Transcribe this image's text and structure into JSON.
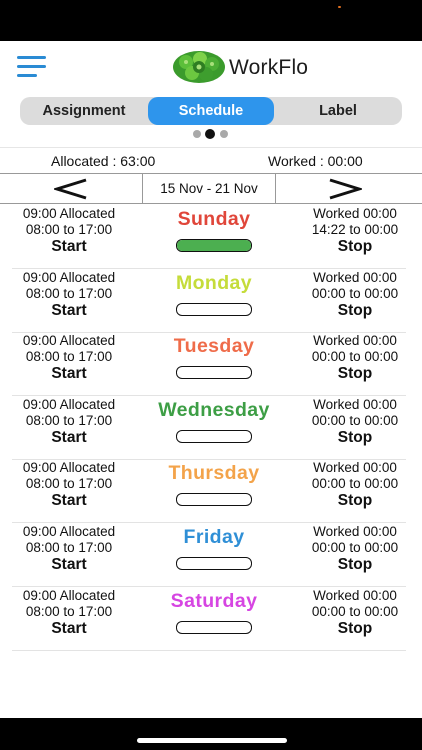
{
  "app": {
    "title": "WorkFlo"
  },
  "header": {
    "menu_icon": "hamburger-menu-icon",
    "logo_icon": "green-gear-logo"
  },
  "tabs": [
    {
      "label": "Assignment",
      "active": false
    },
    {
      "label": "Schedule",
      "active": true
    },
    {
      "label": "Label",
      "active": false
    }
  ],
  "pager": {
    "count": 3,
    "active_index": 1
  },
  "summary": {
    "allocated": "Allocated : 63:00",
    "worked": "Worked : 00:00"
  },
  "week": {
    "range": "15 Nov - 21 Nov",
    "prev_icon": "chevron-left-icon",
    "next_icon": "chevron-right-icon"
  },
  "colors": {
    "accent": "#2e95ec",
    "progress": "#4caf50"
  },
  "days": [
    {
      "name": "Sunday",
      "color": "#e0463a",
      "allocated": "09:00 Allocated",
      "range": "08:00 to 17:00",
      "start_label": "Start",
      "worked": "Worked 00:00",
      "worked_range": "14:22 to 00:00",
      "stop_label": "Stop",
      "progress": 1.0
    },
    {
      "name": "Monday",
      "color": "#c5dc3a",
      "allocated": "09:00 Allocated",
      "range": "08:00 to 17:00",
      "start_label": "Start",
      "worked": "Worked 00:00",
      "worked_range": "00:00 to 00:00",
      "stop_label": "Stop",
      "progress": 0
    },
    {
      "name": "Tuesday",
      "color": "#ef6c4a",
      "allocated": "09:00 Allocated",
      "range": "08:00 to 17:00",
      "start_label": "Start",
      "worked": "Worked 00:00",
      "worked_range": "00:00 to 00:00",
      "stop_label": "Stop",
      "progress": 0
    },
    {
      "name": "Wednesday",
      "color": "#3d9e45",
      "allocated": "09:00 Allocated",
      "range": "08:00 to 17:00",
      "start_label": "Start",
      "worked": "Worked 00:00",
      "worked_range": "00:00 to 00:00",
      "stop_label": "Stop",
      "progress": 0
    },
    {
      "name": "Thursday",
      "color": "#f3a34a",
      "allocated": "09:00 Allocated",
      "range": "08:00 to 17:00",
      "start_label": "Start",
      "worked": "Worked 00:00",
      "worked_range": "00:00 to 00:00",
      "stop_label": "Stop",
      "progress": 0
    },
    {
      "name": "Friday",
      "color": "#2f8fd6",
      "allocated": "09:00 Allocated",
      "range": "08:00 to 17:00",
      "start_label": "Start",
      "worked": "Worked 00:00",
      "worked_range": "00:00 to 00:00",
      "stop_label": "Stop",
      "progress": 0
    },
    {
      "name": "Saturday",
      "color": "#d645e2",
      "allocated": "09:00 Allocated",
      "range": "08:00 to 17:00",
      "start_label": "Start",
      "worked": "Worked 00:00",
      "worked_range": "00:00 to 00:00",
      "stop_label": "Stop",
      "progress": 0
    }
  ]
}
